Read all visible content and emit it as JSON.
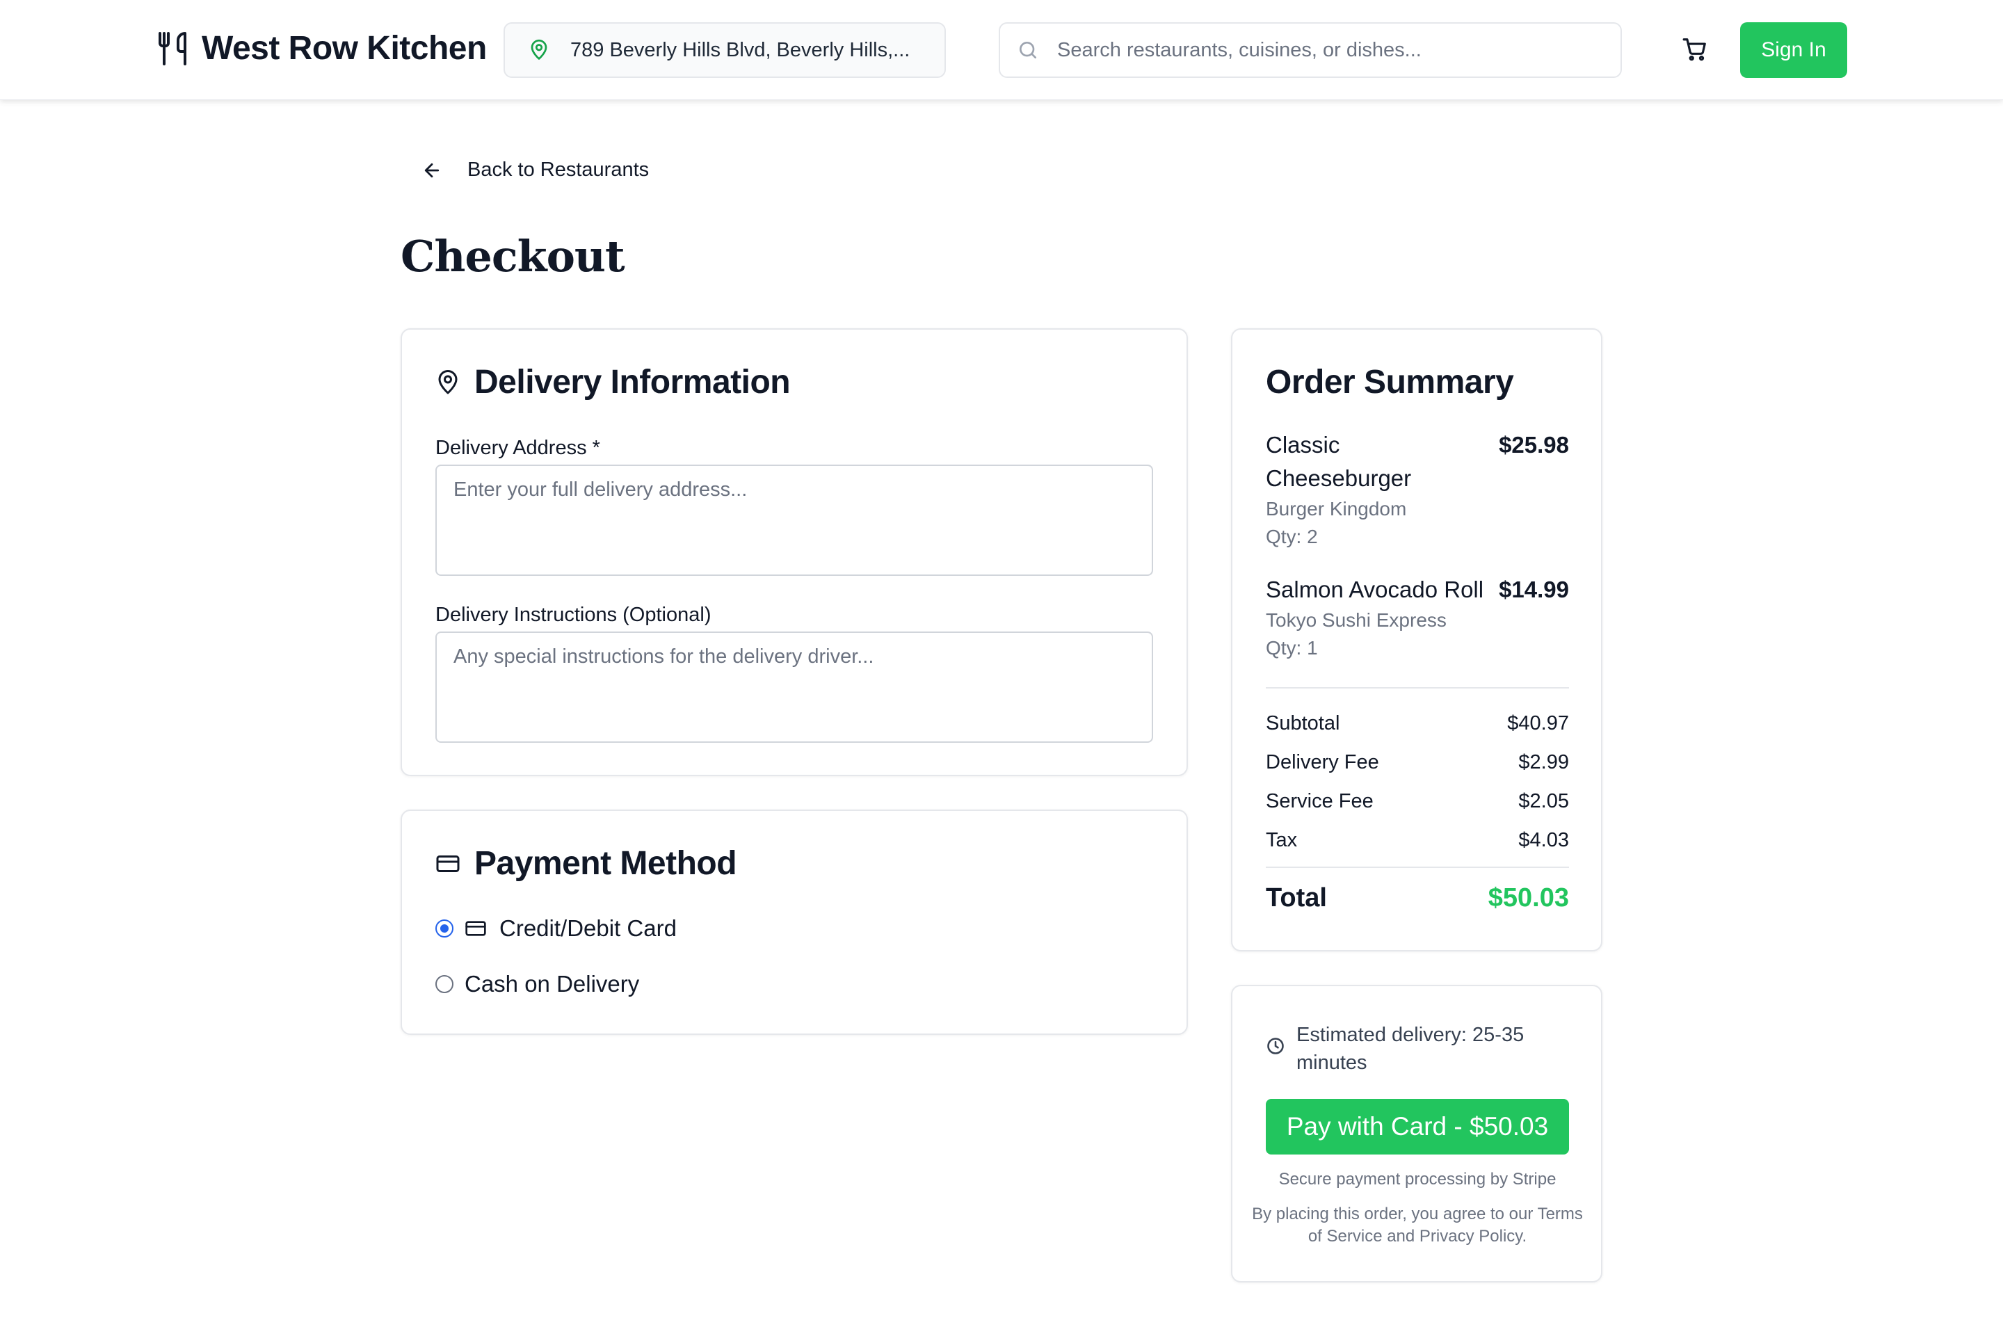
{
  "header": {
    "brand": "West Row Kitchen",
    "location": "789 Beverly Hills Blvd, Beverly Hills,...",
    "search_placeholder": "Search restaurants, cuisines, or dishes...",
    "signin_label": "Sign In",
    "icons": [
      "utensils-icon",
      "map-pin-icon",
      "search-icon",
      "shopping-cart-icon"
    ]
  },
  "nav": {
    "back_label": "Back to Restaurants"
  },
  "page": {
    "title": "Checkout"
  },
  "delivery": {
    "title": "Delivery Information",
    "address_label": "Delivery Address *",
    "address_placeholder": "Enter your full delivery address...",
    "address_value": "",
    "instructions_label": "Delivery Instructions (Optional)",
    "instructions_placeholder": "Any special instructions for the delivery driver...",
    "instructions_value": ""
  },
  "payment": {
    "title": "Payment Method",
    "options": [
      {
        "label": "Credit/Debit Card",
        "selected": true
      },
      {
        "label": "Cash on Delivery",
        "selected": false
      }
    ]
  },
  "summary": {
    "title": "Order Summary",
    "items": [
      {
        "name": "Classic Cheeseburger",
        "price": "$25.98",
        "restaurant": "Burger Kingdom",
        "qty": "Qty: 2"
      },
      {
        "name": "Salmon Avocado Roll",
        "price": "$14.99",
        "restaurant": "Tokyo Sushi Express",
        "qty": "Qty: 1"
      }
    ],
    "lines": [
      {
        "label": "Subtotal",
        "value": "$40.97"
      },
      {
        "label": "Delivery Fee",
        "value": "$2.99"
      },
      {
        "label": "Service Fee",
        "value": "$2.05"
      },
      {
        "label": "Tax",
        "value": "$4.03"
      }
    ],
    "total_label": "Total",
    "total_value": "$50.03"
  },
  "checkout": {
    "eta": "Estimated delivery: 25-35 minutes",
    "pay_button": "Pay with Card - $50.03",
    "secure_note": "Secure payment processing by Stripe",
    "terms_note": "By placing this order, you agree to our Terms of Service and Privacy Policy."
  },
  "colors": {
    "accent": "#22c55e",
    "radio_selected": "#2563eb",
    "border": "#e5e7eb",
    "muted_text": "#6b7280"
  }
}
